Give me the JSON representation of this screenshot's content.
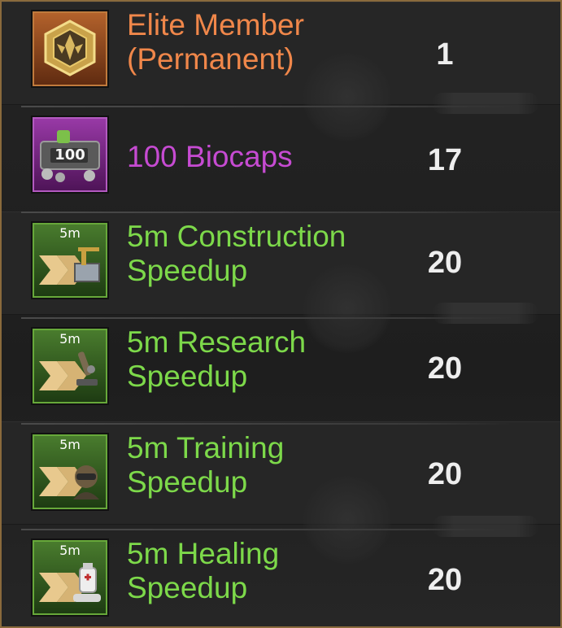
{
  "rewards": [
    {
      "name_line1": "Elite Member",
      "name_line2": "(Permanent)",
      "quantity": "1",
      "rarity": "orange",
      "icon": "elite-badge-icon",
      "icon_tag": ""
    },
    {
      "name_line1": "100 Biocaps",
      "name_line2": "",
      "quantity": "17",
      "rarity": "purple",
      "icon": "biocaps-icon",
      "icon_tag": "100"
    },
    {
      "name_line1": "5m Construction",
      "name_line2": "Speedup",
      "quantity": "20",
      "rarity": "green",
      "icon": "construction-speedup-icon",
      "icon_tag": "5m"
    },
    {
      "name_line1": "5m Research",
      "name_line2": "Speedup",
      "quantity": "20",
      "rarity": "green",
      "icon": "research-speedup-icon",
      "icon_tag": "5m"
    },
    {
      "name_line1": "5m Training",
      "name_line2": "Speedup",
      "quantity": "20",
      "rarity": "green",
      "icon": "training-speedup-icon",
      "icon_tag": "5m"
    },
    {
      "name_line1": "5m Healing",
      "name_line2": "Speedup",
      "quantity": "20",
      "rarity": "green",
      "icon": "healing-speedup-icon",
      "icon_tag": "5m"
    }
  ],
  "colors": {
    "orange": "#f0874a",
    "purple": "#c64bd2",
    "green": "#7dd94a",
    "frame": "#8a6a3c"
  }
}
